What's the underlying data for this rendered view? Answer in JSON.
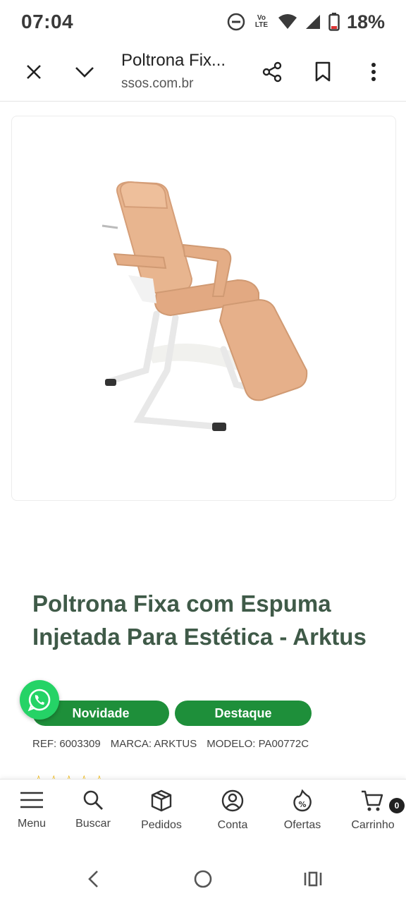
{
  "status": {
    "time": "07:04",
    "network_label": "Vo LTE",
    "battery": "18%"
  },
  "browser": {
    "page_title": "Poltrona Fix...",
    "url": "ssos.com.br"
  },
  "product": {
    "title": "Poltrona Fixa com Espuma Injetada Para Estética - Arktus",
    "badges": [
      "Novidade",
      "Destaque"
    ],
    "ref": "REF: 6003309",
    "brand": "MARCA: ARKTUS",
    "model": "MODELO: PA00772C",
    "rating_stars": "☆☆☆☆☆"
  },
  "bottom_nav": {
    "items": [
      {
        "label": "Menu",
        "icon": "menu-icon"
      },
      {
        "label": "Buscar",
        "icon": "search-icon"
      },
      {
        "label": "Pedidos",
        "icon": "box-icon"
      },
      {
        "label": "Conta",
        "icon": "user-icon"
      },
      {
        "label": "Ofertas",
        "icon": "discount-icon"
      },
      {
        "label": "Carrinho",
        "icon": "cart-icon"
      }
    ],
    "cart_count": "0"
  },
  "colors": {
    "accent_green": "#1e8f3a",
    "title_green": "#3f5a48",
    "whatsapp": "#25d366"
  }
}
